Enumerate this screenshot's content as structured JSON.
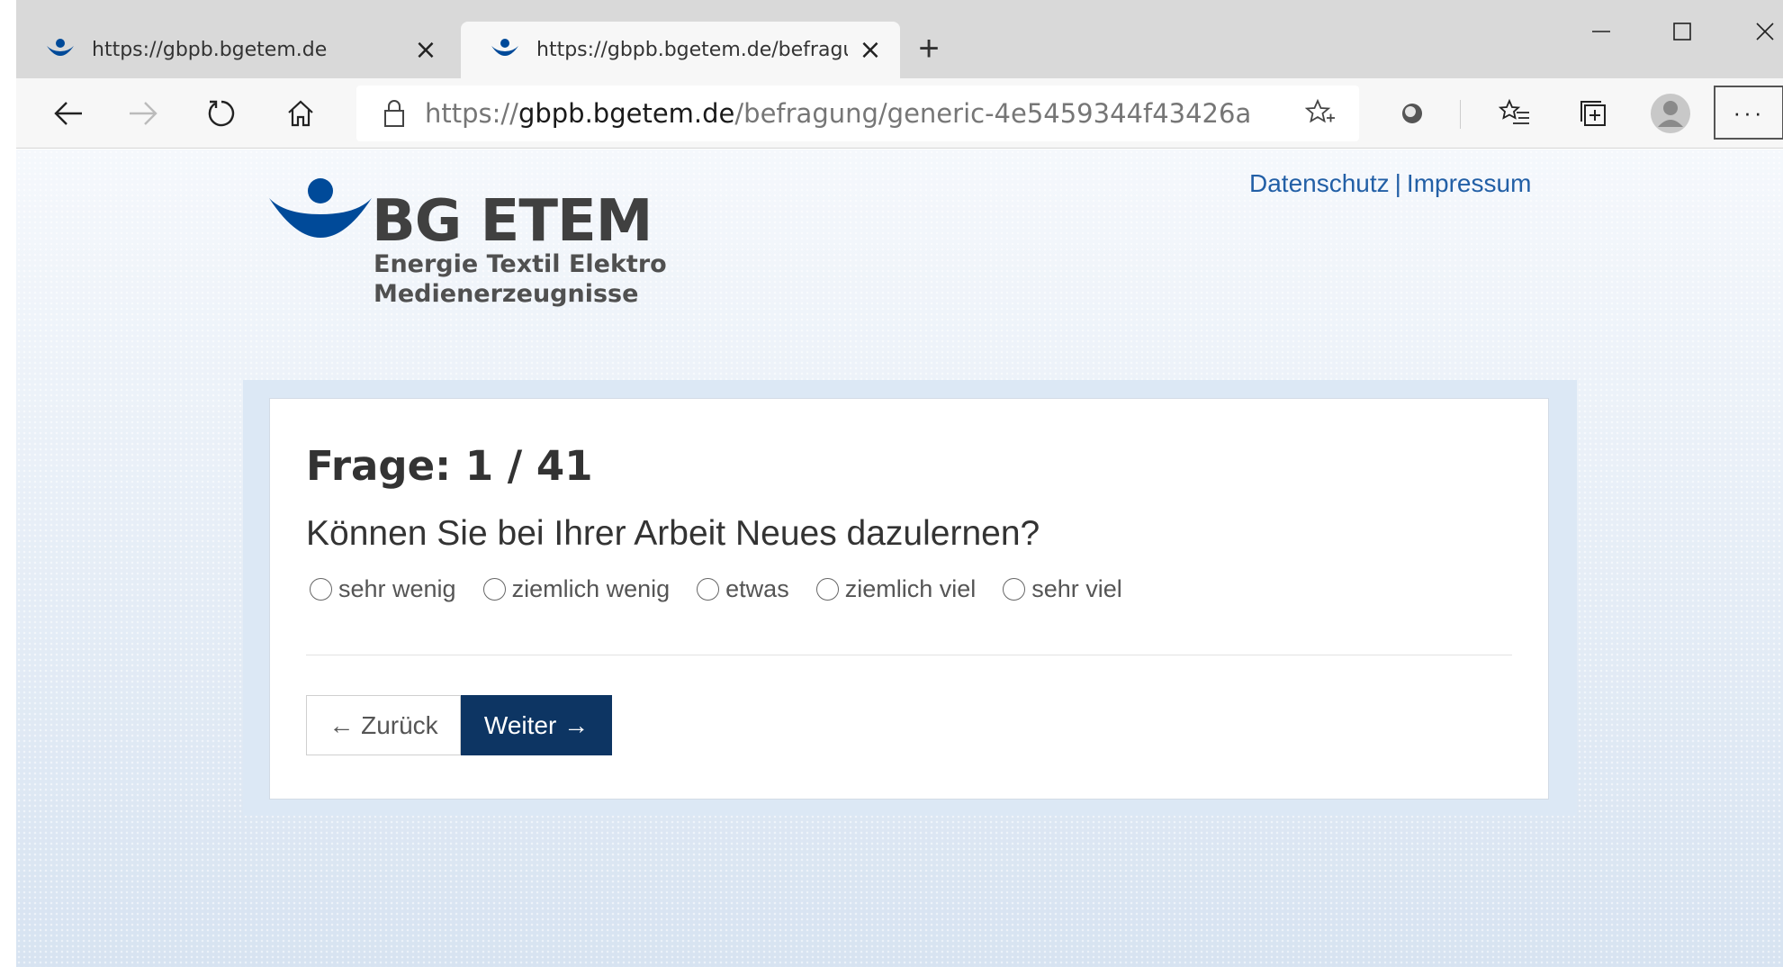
{
  "browser": {
    "tabs": [
      {
        "title": "https://gbpb.bgetem.de",
        "active": false
      },
      {
        "title": "https://gbpb.bgetem.de/befragu",
        "active": true
      }
    ],
    "new_tab_symbol": "+",
    "tab_close_symbol": "×",
    "address": {
      "scheme": "https://",
      "host": "gbpb.bgetem.de",
      "path": "/befragung/generic-4e5459344f43426a..."
    },
    "more_menu_symbol": "···",
    "icons": [
      "back-arrow-icon",
      "forward-arrow-icon",
      "refresh-icon",
      "home-icon",
      "lock-icon",
      "add-favorite-star-icon",
      "extension-icon",
      "favorites-icon",
      "collections-icon",
      "profile-avatar-icon",
      "more-menu-icon",
      "minimize-icon",
      "maximize-icon",
      "close-window-icon"
    ]
  },
  "logo": {
    "title": "BG ETEM",
    "subtitle_line1": "Energie Textil Elektro",
    "subtitle_line2": "Medienerzeugnisse",
    "color": "#004a99"
  },
  "header_links": {
    "privacy": "Datenschutz",
    "separator": "|",
    "imprint": "Impressum"
  },
  "question": {
    "heading": "Frage: 1 / 41",
    "text": "Können Sie bei Ihrer Arbeit Neues dazulernen?",
    "options": [
      "sehr wenig",
      "ziemlich wenig",
      "etwas",
      "ziemlich viel",
      "sehr viel"
    ],
    "selected": null
  },
  "nav": {
    "back_label": "← Zurück",
    "next_label": "Weiter →"
  },
  "colors": {
    "brand_blue": "#004a99",
    "button_dark": "#0d3563",
    "link": "#225fa6"
  }
}
